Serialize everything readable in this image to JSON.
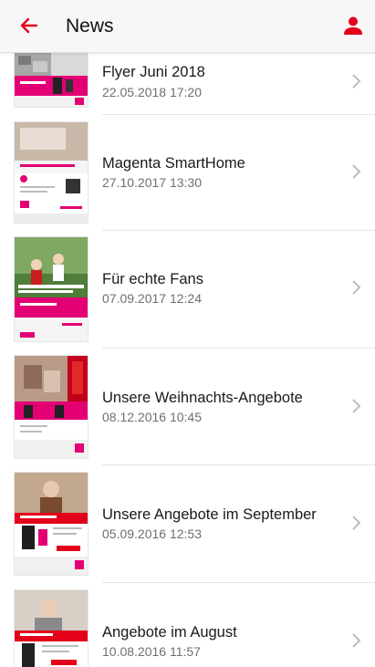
{
  "app": {
    "title": "News",
    "accent": "#e2001a",
    "back_icon": "arrow-left-icon",
    "profile_icon": "person-icon"
  },
  "news": [
    {
      "title": "Flyer Juni 2018",
      "date": "22.05.2018 17:20"
    },
    {
      "title": "Magenta SmartHome",
      "date": "27.10.2017 13:30"
    },
    {
      "title": "Für echte Fans",
      "date": "07.09.2017 12:24"
    },
    {
      "title": "Unsere Weihnachts-Angebote",
      "date": "08.12.2016 10:45"
    },
    {
      "title": "Unsere Angebote im September",
      "date": "05.09.2016 12:53"
    },
    {
      "title": "Angebote im August",
      "date": "10.08.2016 11:57"
    }
  ]
}
